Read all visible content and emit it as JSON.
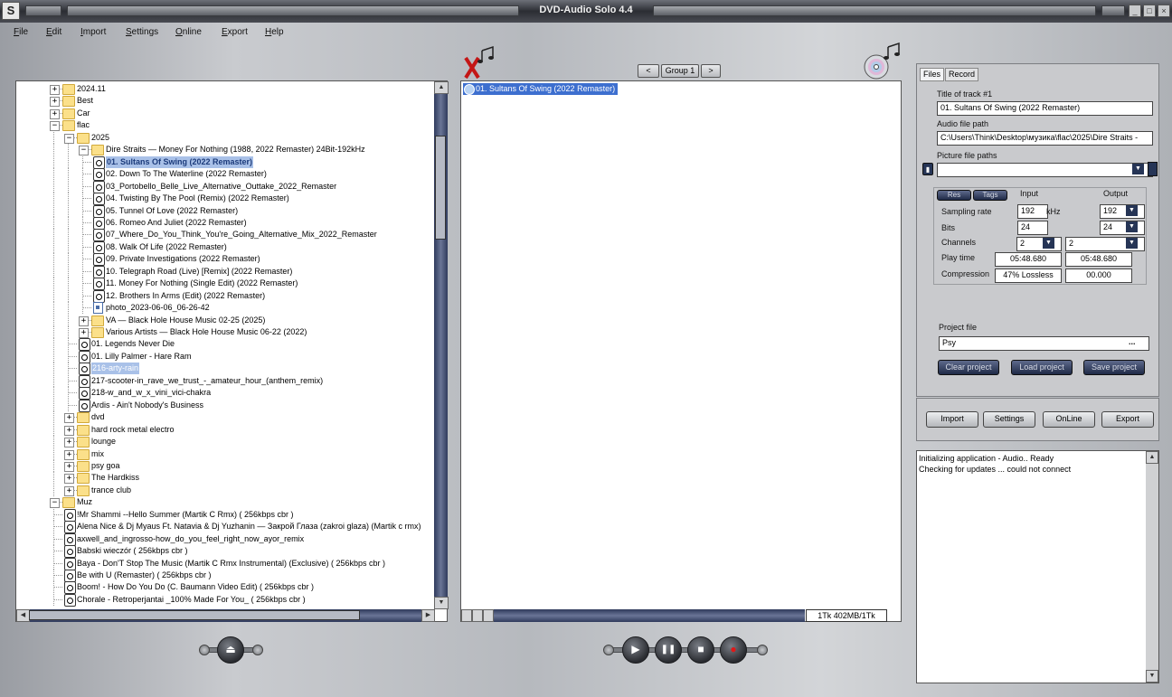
{
  "window": {
    "title": "DVD-Audio Solo 4.4",
    "app_icon_glyph": "S"
  },
  "menu": [
    "File",
    "Edit",
    "Import",
    "Settings",
    "Online",
    "Export",
    "Help"
  ],
  "tree": {
    "rows": [
      {
        "type": "folder",
        "depth": 2,
        "expander": "+",
        "label": "2024.11"
      },
      {
        "type": "folder",
        "depth": 2,
        "expander": "+",
        "label": "Best"
      },
      {
        "type": "folder",
        "depth": 2,
        "expander": "+",
        "label": "Car"
      },
      {
        "type": "folder",
        "depth": 2,
        "expander": "-",
        "label": "flac"
      },
      {
        "type": "folder",
        "depth": 3,
        "expander": "-",
        "label": "2025"
      },
      {
        "type": "folder",
        "depth": 4,
        "expander": "-",
        "label": "Dire Straits — Money For Nothing (1988, 2022 Remaster) 24Bit-192kHz"
      },
      {
        "type": "audio",
        "depth": 5,
        "label": "01. Sultans Of Swing (2022 Remaster)",
        "selected": "bold"
      },
      {
        "type": "audio",
        "depth": 5,
        "label": "02. Down To The Waterline (2022 Remaster)"
      },
      {
        "type": "audio",
        "depth": 5,
        "label": "03_Portobello_Belle_Live_Alternative_Outtake_2022_Remaster"
      },
      {
        "type": "audio",
        "depth": 5,
        "label": "04. Twisting By The Pool (Remix) (2022 Remaster)"
      },
      {
        "type": "audio",
        "depth": 5,
        "label": "05. Tunnel Of Love (2022 Remaster)"
      },
      {
        "type": "audio",
        "depth": 5,
        "label": "06. Romeo And Juliet (2022 Remaster)"
      },
      {
        "type": "audio",
        "depth": 5,
        "label": "07_Where_Do_You_Think_You're_Going_Alternative_Mix_2022_Remaster"
      },
      {
        "type": "audio",
        "depth": 5,
        "label": "08. Walk Of Life (2022 Remaster)"
      },
      {
        "type": "audio",
        "depth": 5,
        "label": "09. Private Investigations (2022 Remaster)"
      },
      {
        "type": "audio",
        "depth": 5,
        "label": "10. Telegraph Road (Live) [Remix] (2022 Remaster)"
      },
      {
        "type": "audio",
        "depth": 5,
        "label": "11. Money For Nothing (Single Edit) (2022 Remaster)"
      },
      {
        "type": "audio",
        "depth": 5,
        "label": "12. Brothers In Arms (Edit) (2022 Remaster)"
      },
      {
        "type": "photo",
        "depth": 5,
        "label": "photo_2023-06-06_06-26-42"
      },
      {
        "type": "folder",
        "depth": 4,
        "expander": "+",
        "label": "VA — Black Hole House Music 02-25 (2025)"
      },
      {
        "type": "folder",
        "depth": 4,
        "expander": "+",
        "label": "Various Artists — Black Hole House Music 06-22 (2022)"
      },
      {
        "type": "audio",
        "depth": 4,
        "label": "01. Legends Never Die"
      },
      {
        "type": "audio",
        "depth": 4,
        "label": "01. Lilly Palmer - Hare Ram"
      },
      {
        "type": "audio",
        "depth": 4,
        "label": "216-arty-rain",
        "selected": "plain"
      },
      {
        "type": "audio",
        "depth": 4,
        "label": "217-scooter-in_rave_we_trust_-_amateur_hour_(anthem_remix)"
      },
      {
        "type": "audio",
        "depth": 4,
        "label": "218-w_and_w_x_vini_vici-chakra"
      },
      {
        "type": "audio",
        "depth": 4,
        "label": "Ardis - Ain't Nobody's Business"
      },
      {
        "type": "folder",
        "depth": 3,
        "expander": "+",
        "label": "dvd"
      },
      {
        "type": "folder",
        "depth": 3,
        "expander": "+",
        "label": "hard rock metal electro"
      },
      {
        "type": "folder",
        "depth": 3,
        "expander": "+",
        "label": "lounge"
      },
      {
        "type": "folder",
        "depth": 3,
        "expander": "+",
        "label": "mix"
      },
      {
        "type": "folder",
        "depth": 3,
        "expander": "+",
        "label": "psy goa"
      },
      {
        "type": "folder",
        "depth": 3,
        "expander": "+",
        "label": "The Hardkiss"
      },
      {
        "type": "folder",
        "depth": 3,
        "expander": "+",
        "label": "trance club"
      },
      {
        "type": "folder",
        "depth": 2,
        "expander": "-",
        "label": "Muz"
      },
      {
        "type": "audio",
        "depth": 3,
        "label": "!Mr Shammi --Hello Summer (Martik C Rmx) ( 256kbps cbr )"
      },
      {
        "type": "audio",
        "depth": 3,
        "label": "Alena Nice & Dj Myaus Ft. Natavia & Dj Yuzhanin — Закрой Глаза (zakroi glaza) (Martik c rmx)"
      },
      {
        "type": "audio",
        "depth": 3,
        "label": "axwell_and_ingrosso-how_do_you_feel_right_now_ayor_remix"
      },
      {
        "type": "audio",
        "depth": 3,
        "label": "Babski wieczór ( 256kbps cbr )"
      },
      {
        "type": "audio",
        "depth": 3,
        "label": "Baya - Don'T Stop The Music (Martik C Rmx Instrumental) (Exclusive) ( 256kbps cbr )"
      },
      {
        "type": "audio",
        "depth": 3,
        "label": "Be with U (Remaster) ( 256kbps cbr )"
      },
      {
        "type": "audio",
        "depth": 3,
        "label": "Boom! - How Do You Do (C. Baumann Video Edit) ( 256kbps cbr )"
      },
      {
        "type": "audio",
        "depth": 3,
        "label": "Chorale - Retroperjantai _100% Made For You_ ( 256kbps cbr )"
      }
    ]
  },
  "group_nav": {
    "prev": "<",
    "label": "Group 1",
    "next": ">"
  },
  "tracklist": {
    "items": [
      "01. Sultans Of Swing (2022 Remaster)"
    ],
    "status": "1Tk 402MB/1Tk"
  },
  "props": {
    "tabs": [
      "Files",
      "Record"
    ],
    "title_label": "Title of track #1",
    "title_value": "01. Sultans Of Swing (2022 Remaster)",
    "audio_path_label": "Audio file path",
    "audio_path_value": "C:\\Users\\Think\\Desktop\\музика\\flac\\2025\\Dire Straits -",
    "picture_label": "Picture file paths",
    "picture_value": "",
    "mini_tabs": [
      "Res",
      "Tags"
    ],
    "col_input": "Input",
    "col_output": "Output",
    "sampling_label": "Sampling rate",
    "sampling_in": "192",
    "sampling_unit": "kHz",
    "sampling_out": "192",
    "bits_label": "Bits",
    "bits_in": "24",
    "bits_out": "24",
    "channels_label": "Channels",
    "channels_in": "2",
    "channels_out": "2",
    "playtime_label": "Play time",
    "playtime_in": "05:48.680",
    "playtime_out": "05:48.680",
    "compression_label": "Compression",
    "compression_in": "47% Lossless",
    "compression_out": "00.000",
    "project_label": "Project file",
    "project_value": "Psy",
    "project_browse": "...",
    "clear_project": "Clear project",
    "load_project": "Load project",
    "save_project": "Save project"
  },
  "actions": [
    "Import",
    "Settings",
    "OnLine",
    "Export"
  ],
  "log": [
    "Initializing application - Audio.. Ready",
    "Checking for updates ... could not connect"
  ]
}
